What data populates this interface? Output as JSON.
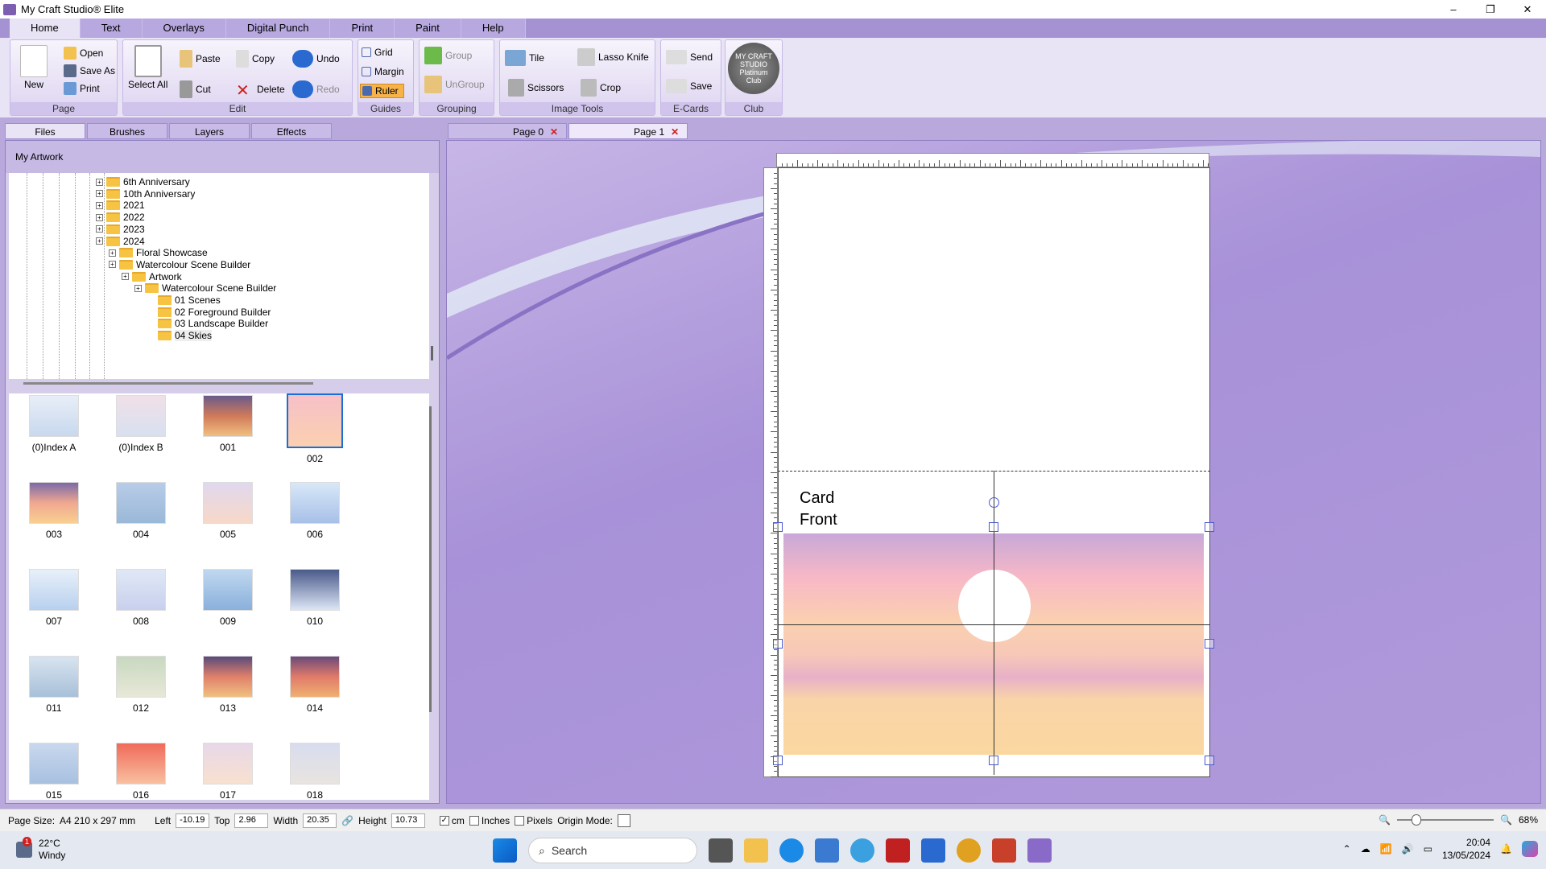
{
  "window": {
    "title": "My Craft Studio® Elite",
    "controls": [
      "–",
      "❐",
      "✕"
    ]
  },
  "ribbon_tabs": [
    "Home",
    "Text",
    "Overlays",
    "Digital Punch",
    "Print",
    "Paint",
    "Help"
  ],
  "ribbon": {
    "page": {
      "label": "Page",
      "new": "New",
      "open": "Open",
      "save_as": "Save As",
      "print": "Print"
    },
    "edit": {
      "label": "Edit",
      "select_all": "Select All",
      "paste": "Paste",
      "cut": "Cut",
      "copy": "Copy",
      "delete": "Delete",
      "undo": "Undo",
      "redo": "Redo"
    },
    "guides": {
      "label": "Guides",
      "grid": "Grid",
      "margin": "Margin",
      "ruler": "Ruler"
    },
    "grouping": {
      "label": "Grouping",
      "group": "Group",
      "ungroup": "UnGroup"
    },
    "image_tools": {
      "label": "Image Tools",
      "tile": "Tile",
      "lasso": "Lasso Knife",
      "scissors": "Scissors",
      "crop": "Crop"
    },
    "ecards": {
      "label": "E-Cards",
      "send": "Send",
      "save": "Save"
    },
    "club": {
      "label": "Club",
      "logo_text": "MY CRAFT STUDIO Platinum Club"
    }
  },
  "panel_tabs": [
    "Files",
    "Brushes",
    "Layers",
    "Effects"
  ],
  "panel_header": "My Artwork",
  "tree": [
    {
      "label": "6th Anniversary",
      "indent": 0
    },
    {
      "label": "10th Anniversary",
      "indent": 0
    },
    {
      "label": "2021",
      "indent": 0
    },
    {
      "label": "2022",
      "indent": 0
    },
    {
      "label": "2023",
      "indent": 0
    },
    {
      "label": "2024",
      "indent": 0
    },
    {
      "label": "Floral Showcase",
      "indent": 1
    },
    {
      "label": "Watercolour Scene Builder",
      "indent": 1
    },
    {
      "label": "Artwork",
      "indent": 2
    },
    {
      "label": "Watercolour Scene Builder",
      "indent": 3
    },
    {
      "label": "01 Scenes",
      "indent": 4
    },
    {
      "label": "02 Foreground Builder",
      "indent": 4
    },
    {
      "label": "03 Landscape Builder",
      "indent": 4
    },
    {
      "label": "04 Skies",
      "indent": 4
    }
  ],
  "thumbnails": [
    "(0)Index A",
    "(0)Index B",
    "001",
    "002",
    "003",
    "004",
    "005",
    "006",
    "007",
    "008",
    "009",
    "010",
    "011",
    "012",
    "013",
    "014",
    "015",
    "016",
    "017",
    "018"
  ],
  "selected_thumbnail": "002",
  "doc_tabs": [
    "Page 0",
    "Page 1"
  ],
  "active_doc_tab": "Page 1",
  "card": {
    "line1": "Card",
    "line2": "Front"
  },
  "status": {
    "page_size_label": "Page Size:",
    "page_size": "A4 210 x 297 mm",
    "left_label": "Left",
    "left": "-10.19",
    "top_label": "Top",
    "top": "2.96",
    "width_label": "Width",
    "width": "20.35",
    "height_label": "Height",
    "height": "10.73",
    "cm": "cm",
    "inches": "Inches",
    "pixels": "Pixels",
    "origin_label": "Origin Mode:",
    "zoom": "68%"
  },
  "taskbar": {
    "temp": "22°C",
    "weather": "Windy",
    "search": "Search",
    "time": "20:04",
    "date": "13/05/2024",
    "weather_badge": "1"
  },
  "colors": {
    "accent": "#a592d2",
    "ribbon_bg": "#e9e3f6",
    "selection": "#1a6fd6"
  }
}
